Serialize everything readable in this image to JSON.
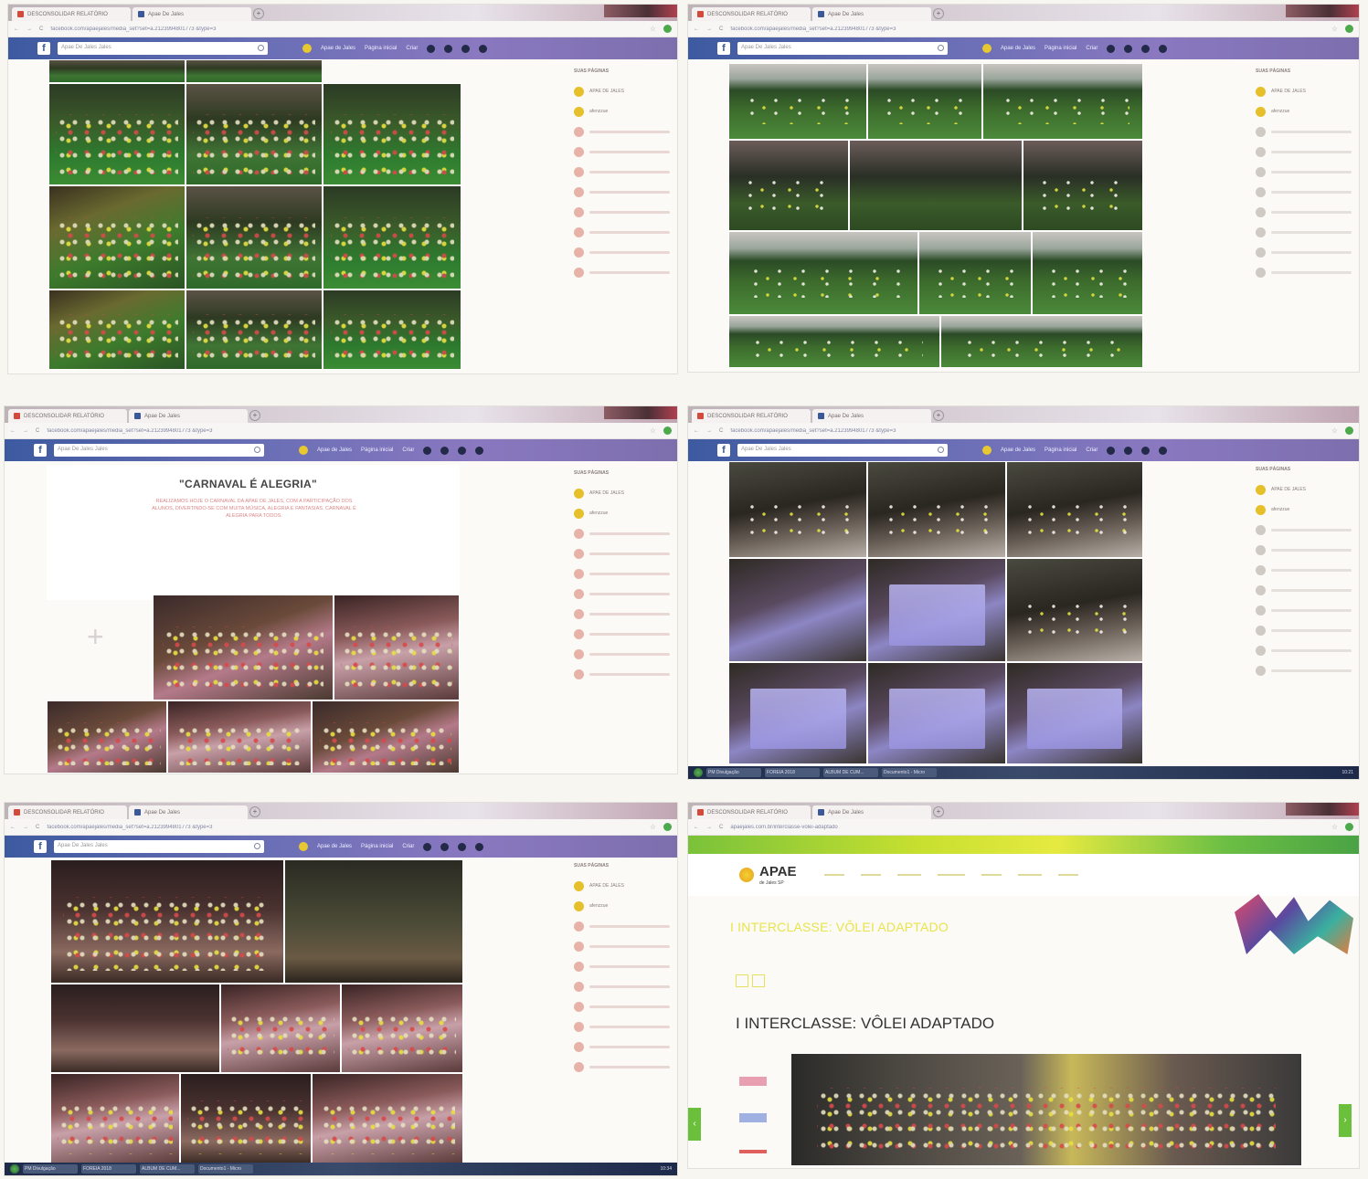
{
  "shots": {
    "s1": {
      "tabs": [
        "DESCONSOLIDAR RELATÓRIO",
        "Apae De Jales"
      ],
      "url": "facebook.com/apaejales/media_set?set=a.2123994801773 &type=3",
      "search_placeholder": "Apae De Jales Jales",
      "nav": [
        "Apae de Jales",
        "Página inicial",
        "Criar"
      ],
      "right_header": "SUAS PÁGINAS",
      "right_items": [
        "APAE DE JALES",
        "afenzzue"
      ]
    },
    "s2": {
      "tabs": [
        "DESCONSOLIDAR RELATÓRIO",
        "Apae De Jales"
      ],
      "url": "facebook.com/apaejales/media_set?set=a.2123994801773 &type=3",
      "search_placeholder": "Apae De Jales Jales",
      "nav": [
        "Apae de Jales",
        "Página inicial",
        "Criar"
      ],
      "right_header": "SUAS PÁGINAS",
      "right_items": [
        "APAE DE JALES",
        "afenzzue"
      ]
    },
    "s3": {
      "tabs": [
        "DESCONSOLIDAR RELATÓRIO",
        "Apae De Jales"
      ],
      "url": "facebook.com/apaejales/media_set?set=a.2123994801773 &type=3",
      "search_placeholder": "Apae De Jales Jales",
      "nav": [
        "Apae de Jales",
        "Página inicial",
        "Criar"
      ],
      "post_title": "\"CARNAVAL É ALEGRIA\"",
      "post_body": "REALIZAMOS HOJE O CARNAVAL DA APAE DE JALES, COM A PARTICIPAÇÃO DOS ALUNOS, DIVERTINDO-SE COM MUITA MÚSICA, ALEGRIA E FANTASIAS. CARNAVAL É ALEGRIA PARA TODOS.",
      "right_header": "SUAS PÁGINAS",
      "right_items": [
        "APAE DE JALES",
        "afenzzue"
      ]
    },
    "s4": {
      "tabs": [
        "DESCONSOLIDAR RELATÓRIO",
        "Apae De Jales"
      ],
      "url": "facebook.com/apaejales/media_set?set=a.2123994801773 &type=3",
      "search_placeholder": "Apae De Jales Jales",
      "nav": [
        "Apae de Jales",
        "Página inicial",
        "Criar"
      ],
      "right_header": "SUAS PÁGINAS",
      "right_items": [
        "APAE DE JALES",
        "afenzzue"
      ],
      "taskbar": [
        "PM Divulgação",
        "FOREIA 2018",
        "ALBUM DE CUM...",
        "Documento1 - Micro"
      ],
      "clock": "10:21"
    },
    "s5": {
      "tabs": [
        "DESCONSOLIDAR RELATÓRIO",
        "Apae De Jales"
      ],
      "url": "facebook.com/apaejales/media_set?set=a.2123994801773 &type=3",
      "search_placeholder": "Apae De Jales Jales",
      "nav": [
        "Apae de Jales",
        "Página inicial",
        "Criar"
      ],
      "right_header": "SUAS PÁGINAS",
      "right_items": [
        "APAE DE JALES",
        "afenzzue"
      ],
      "taskbar": [
        "PM Divulgação",
        "FOREIA 2018",
        "ALBUM DE CUM...",
        "Documento1 - Micro"
      ],
      "clock": "10:34"
    },
    "s6": {
      "tabs": [
        "DESCONSOLIDAR RELATÓRIO",
        "Apae De Jales"
      ],
      "url": "apaejales.com.br/interclasse-volei-adaptado",
      "logo": "APAE",
      "logo_sub": "de Jales SP",
      "headline": "I INTERCLASSE: VÔLEI ADAPTADO",
      "headline2": "I INTERCLASSE: VÔLEI ADAPTADO"
    }
  },
  "colors": {
    "fb_blue": "#3d5aa0",
    "apae_green": "#7ac23a",
    "apae_yellow": "#e6ea40"
  }
}
